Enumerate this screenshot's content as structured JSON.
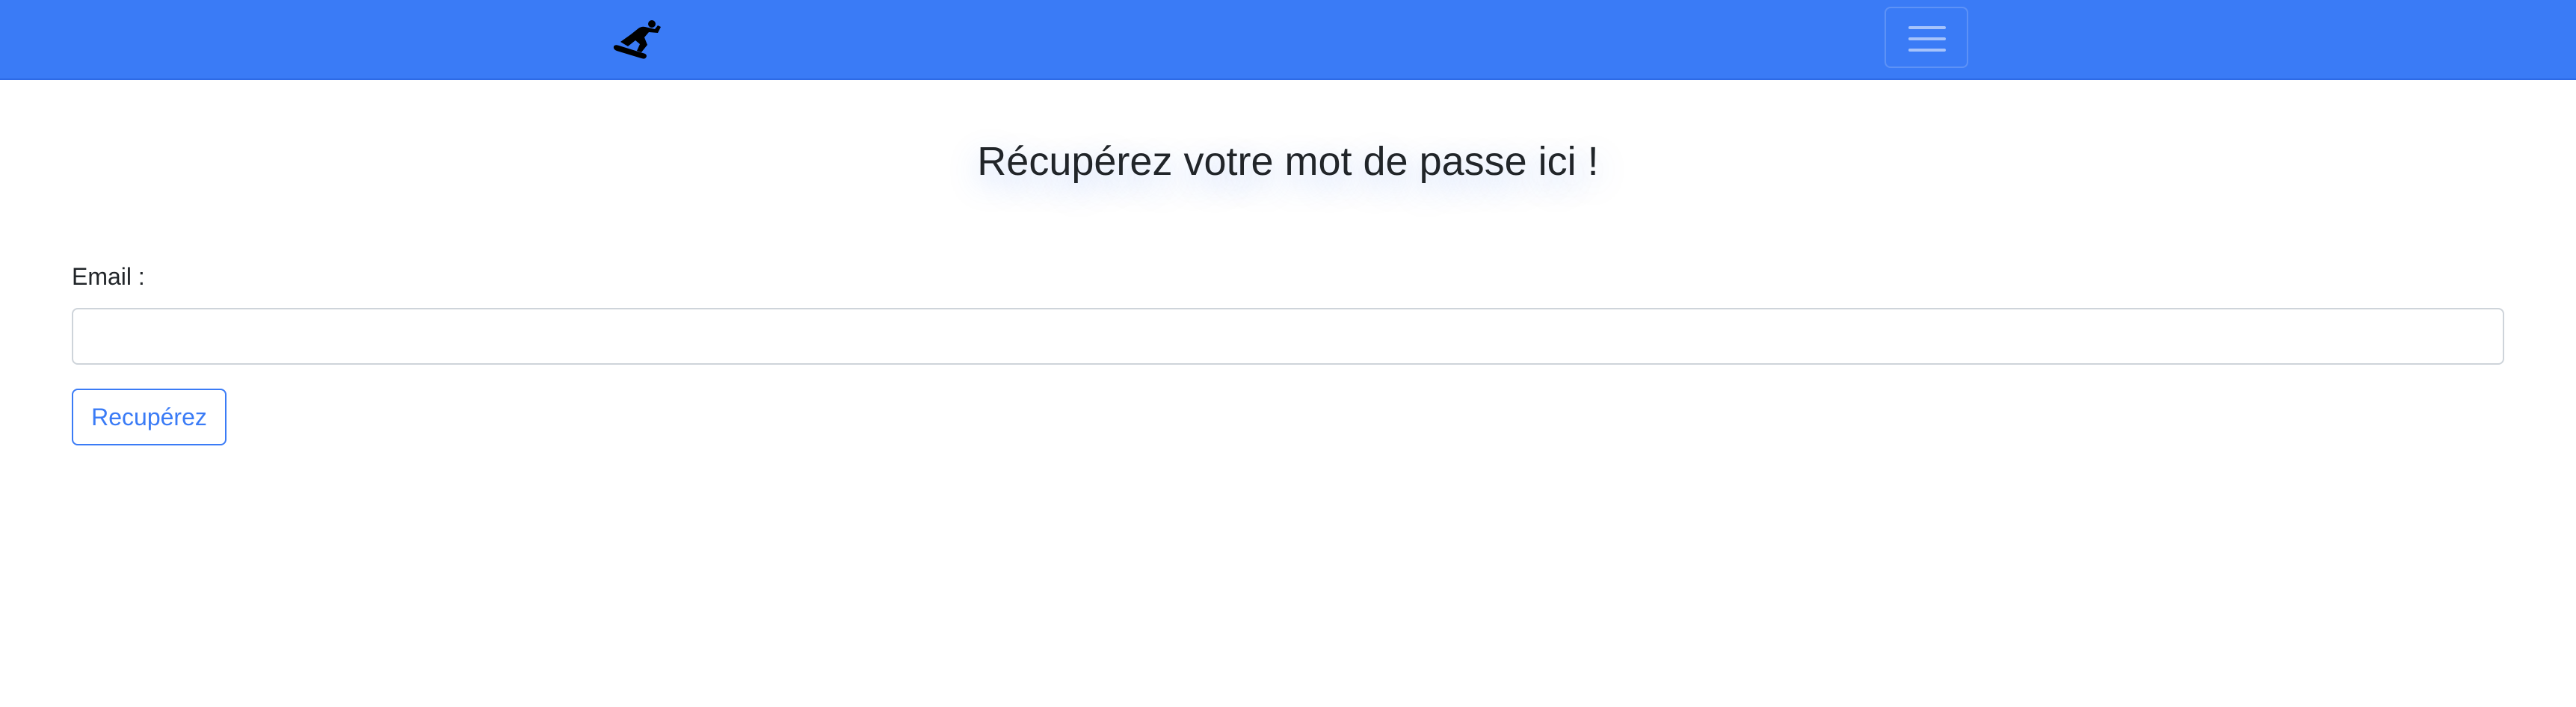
{
  "navbar": {
    "logo_icon": "snowboarder-icon",
    "toggler_icon": "hamburger-menu-icon",
    "background_color": "#3a7bf6"
  },
  "main": {
    "title": "Récupérez votre mot de passe ici !",
    "email_label": "Email :",
    "email_value": "",
    "email_placeholder": "",
    "submit_label": "Recupérez",
    "accent_color": "#3a7bf6"
  }
}
